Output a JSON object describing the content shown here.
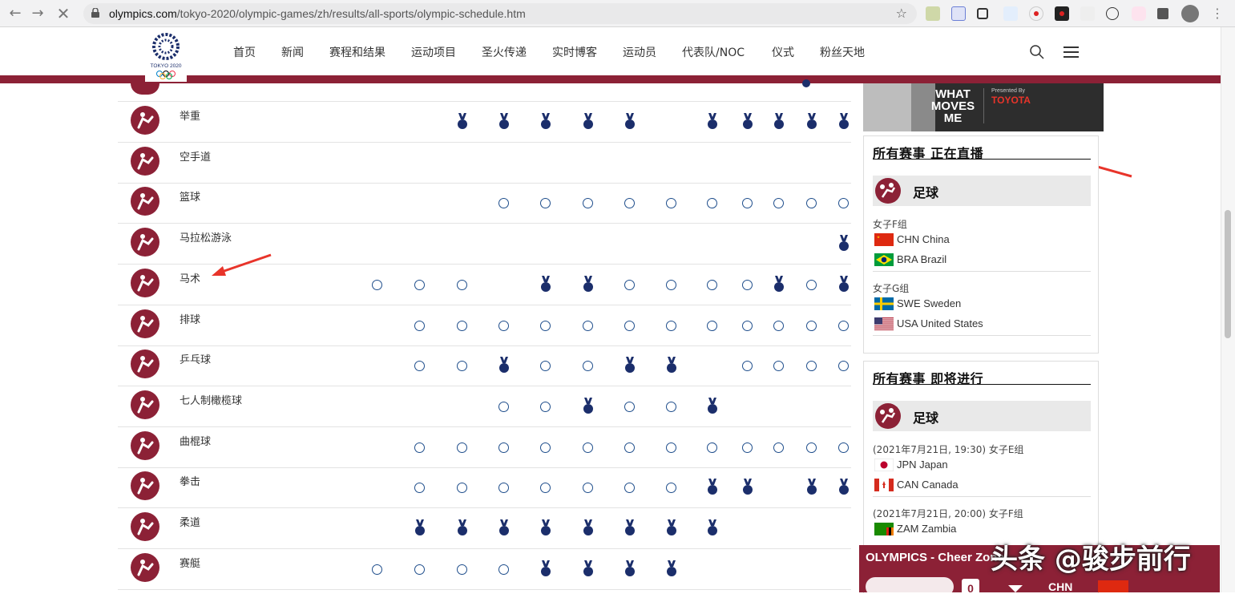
{
  "browser": {
    "url_domain": "olympics.com",
    "url_path": "/tokyo-2020/olympic-games/zh/results/all-sports/olympic-schedule.htm"
  },
  "site": {
    "logo_text": "TOKYO 2020",
    "nav": [
      "首页",
      "新闻",
      "赛程和结果",
      "运动项目",
      "圣火传递",
      "实时博客",
      "运动员",
      "代表队/NOC",
      "仪式",
      "粉丝天地"
    ]
  },
  "schedule": {
    "columns": 13,
    "rows": [
      {
        "sport": "举重",
        "icon": "weightlifting-icon",
        "cells": [
          "",
          "",
          "m",
          "m",
          "m",
          "m",
          "m",
          "",
          "m",
          "m",
          "m",
          "m",
          "m"
        ]
      },
      {
        "sport": "空手道",
        "icon": "karate-icon",
        "cells": [
          "",
          "",
          "",
          "",
          "",
          "",
          "",
          "",
          "",
          "",
          "",
          "",
          ""
        ]
      },
      {
        "sport": "篮球",
        "icon": "basketball-icon",
        "cells": [
          "",
          "",
          "",
          "c",
          "c",
          "c",
          "c",
          "c",
          "c",
          "c",
          "c",
          "c",
          "c"
        ]
      },
      {
        "sport": "马拉松游泳",
        "icon": "marathon-swimming-icon",
        "cells": [
          "",
          "",
          "",
          "",
          "",
          "",
          "",
          "",
          "",
          "",
          "",
          "",
          "m"
        ]
      },
      {
        "sport": "马术",
        "icon": "equestrian-icon",
        "cells": [
          "c",
          "c",
          "c",
          "",
          "m",
          "m",
          "c",
          "c",
          "c",
          "c",
          "m",
          "c",
          "m"
        ]
      },
      {
        "sport": "排球",
        "icon": "volleyball-icon",
        "cells": [
          "",
          "c",
          "c",
          "c",
          "c",
          "c",
          "c",
          "c",
          "c",
          "c",
          "c",
          "c",
          "c"
        ]
      },
      {
        "sport": "乒乓球",
        "icon": "table-tennis-icon",
        "cells": [
          "",
          "c",
          "c",
          "m",
          "c",
          "c",
          "m",
          "m",
          "",
          "c",
          "c",
          "c",
          "c"
        ]
      },
      {
        "sport": "七人制橄榄球",
        "icon": "rugby-sevens-icon",
        "cells": [
          "",
          "",
          "",
          "c",
          "c",
          "m",
          "c",
          "c",
          "m",
          "",
          "",
          "",
          ""
        ]
      },
      {
        "sport": "曲棍球",
        "icon": "hockey-icon",
        "cells": [
          "",
          "c",
          "c",
          "c",
          "c",
          "c",
          "c",
          "c",
          "c",
          "c",
          "c",
          "c",
          "c"
        ]
      },
      {
        "sport": "拳击",
        "icon": "boxing-icon",
        "cells": [
          "",
          "c",
          "c",
          "c",
          "c",
          "c",
          "c",
          "c",
          "m",
          "m",
          "",
          "m",
          "m"
        ]
      },
      {
        "sport": "柔道",
        "icon": "judo-icon",
        "cells": [
          "",
          "m",
          "m",
          "m",
          "m",
          "m",
          "m",
          "m",
          "m",
          "",
          "",
          "",
          ""
        ]
      },
      {
        "sport": "赛艇",
        "icon": "rowing-icon",
        "cells": [
          "c",
          "c",
          "c",
          "c",
          "m",
          "m",
          "m",
          "m",
          "",
          "",
          "",
          "",
          ""
        ]
      }
    ]
  },
  "sidebar": {
    "live": {
      "title": "所有赛事 正在直播",
      "sport": "足球",
      "groups": [
        {
          "name": "女子F组",
          "teams": [
            {
              "code": "CHN China",
              "flag": "cn"
            },
            {
              "code": "BRA Brazil",
              "flag": "br"
            }
          ]
        },
        {
          "name": "女子G组",
          "teams": [
            {
              "code": "SWE Sweden",
              "flag": "se"
            },
            {
              "code": "USA United States",
              "flag": "us"
            }
          ]
        }
      ]
    },
    "upcoming": {
      "title": "所有赛事 即将进行",
      "sport": "足球",
      "groups": [
        {
          "name": "(2021年7月21日, 19:30) 女子E组",
          "teams": [
            {
              "code": "JPN Japan",
              "flag": "jp"
            },
            {
              "code": "CAN Canada",
              "flag": "ca"
            }
          ]
        },
        {
          "name": "(2021年7月21日, 20:00) 女子F组",
          "teams": [
            {
              "code": "ZAM Zambia",
              "flag": "zm"
            }
          ]
        }
      ]
    }
  },
  "ad": {
    "line1": "WHAT",
    "line2": "MOVES",
    "line3": "ME",
    "presented": "Presented By",
    "brand": "TOYOTA"
  },
  "cheer": {
    "title": "OLYMPICS - Cheer Zone",
    "count": "0",
    "code": "CHN"
  },
  "watermark": "头条 @骏步前行",
  "colors": {
    "brand": "#8c2136",
    "medal": "#1b2e6b",
    "circle": "#1f4e8c"
  }
}
